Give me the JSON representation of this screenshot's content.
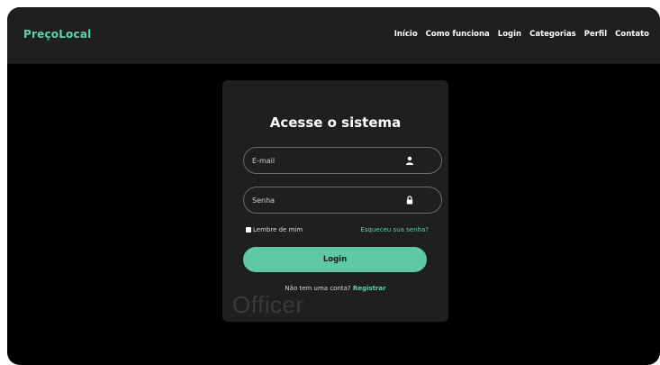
{
  "navbar": {
    "brand": "PreçoLocal",
    "links": [
      "Início",
      "Como funciona",
      "Login",
      "Categorias",
      "Perfil",
      "Contato"
    ]
  },
  "login_card": {
    "title": "Acesse o sistema",
    "email_placeholder": "E-mail",
    "email_icon": "user-icon",
    "password_placeholder": "Senha",
    "password_icon": "lock-icon",
    "remember_label": "Lembre de mim",
    "forgot_label": "Esqueceu sua senha?",
    "login_button": "Login",
    "register_prompt": "Não tem uma conta?",
    "register_link": "Registrar"
  },
  "overlay": {
    "text": "Officer"
  },
  "colors": {
    "accent": "#5fd2a6",
    "button": "#5fc9a3",
    "navbar_bg": "#1f1f1f",
    "page_bg": "#000000",
    "card_bg": "#1f1f1f"
  }
}
